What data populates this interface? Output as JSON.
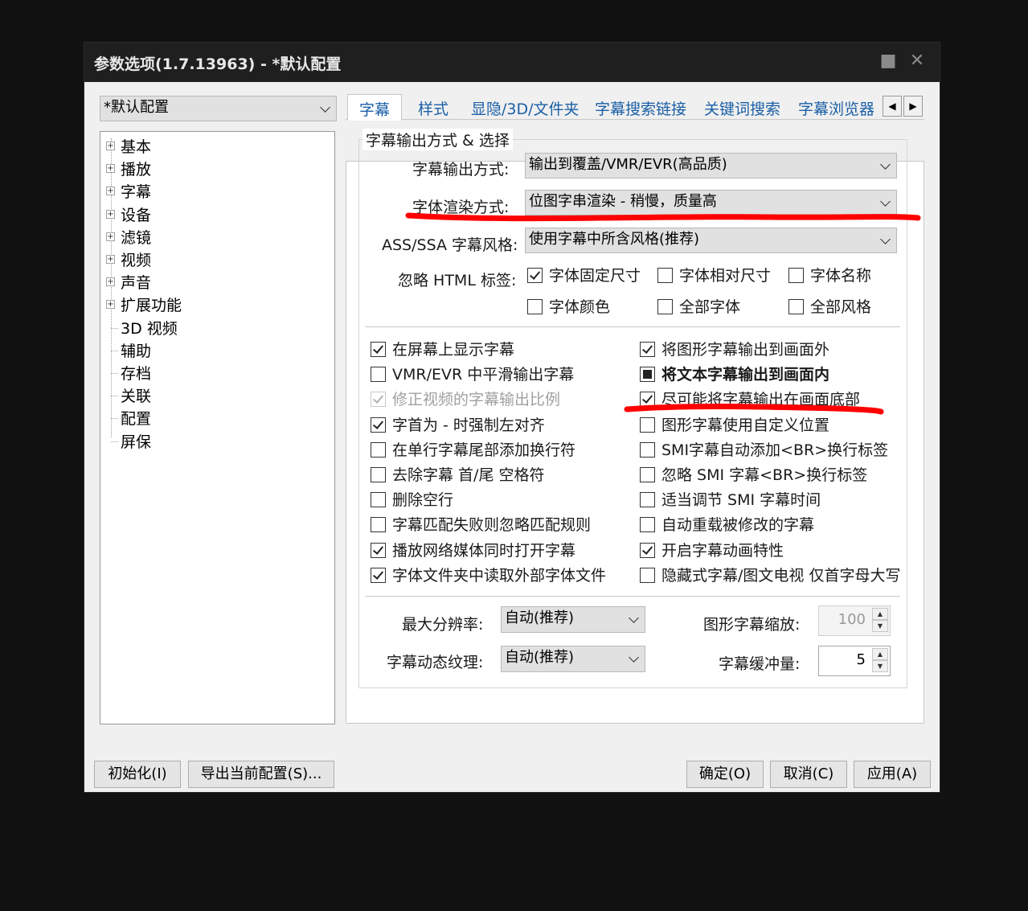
{
  "window": {
    "title": "参数选项(1.7.13963) - *默认配置",
    "pin_icon": "pin-icon",
    "close_icon": "close-icon"
  },
  "profile": {
    "value": "*默认配置"
  },
  "tree": {
    "items": [
      {
        "label": "基本",
        "expandable": true
      },
      {
        "label": "播放",
        "expandable": true
      },
      {
        "label": "字幕",
        "expandable": true
      },
      {
        "label": "设备",
        "expandable": true
      },
      {
        "label": "滤镜",
        "expandable": true
      },
      {
        "label": "视频",
        "expandable": true
      },
      {
        "label": "声音",
        "expandable": true
      },
      {
        "label": "扩展功能",
        "expandable": true
      },
      {
        "label": "3D 视频",
        "expandable": false
      },
      {
        "label": "辅助",
        "expandable": false
      },
      {
        "label": "存档",
        "expandable": false
      },
      {
        "label": "关联",
        "expandable": false
      },
      {
        "label": "配置",
        "expandable": false
      },
      {
        "label": "屏保",
        "expandable": false
      }
    ]
  },
  "tabs": [
    {
      "label": "字幕",
      "active": true
    },
    {
      "label": "样式"
    },
    {
      "label": "显隐/3D/文件夹"
    },
    {
      "label": "字幕搜索链接"
    },
    {
      "label": "关键词搜索"
    },
    {
      "label": "字幕浏览器"
    }
  ],
  "tab_scroll": {
    "left_icon": "arrow-left-icon",
    "right_icon": "arrow-right-icon",
    "left": "◀",
    "right": "▶"
  },
  "group": {
    "title": "字幕输出方式 & 选择",
    "output_mode_label": "字幕输出方式:",
    "output_mode_value": "输出到覆盖/VMR/EVR(高品质)",
    "font_render_label": "字体渲染方式:",
    "font_render_value": "位图字串渲染 - 稍慢，质量高",
    "ass_label": "ASS/SSA 字幕风格:",
    "ass_value": "使用字幕中所含风格(推荐)",
    "ignore_html_label": "忽略 HTML 标签:",
    "ignore_html": [
      {
        "label": "字体固定尺寸",
        "checked": true
      },
      {
        "label": "字体相对尺寸",
        "checked": false
      },
      {
        "label": "字体名称",
        "checked": false
      },
      {
        "label": "字体颜色",
        "checked": false
      },
      {
        "label": "全部字体",
        "checked": false
      },
      {
        "label": "全部风格",
        "checked": false
      }
    ],
    "options_left": [
      {
        "label": "在屏幕上显示字幕",
        "state": "checked"
      },
      {
        "label": "VMR/EVR 中平滑输出字幕",
        "state": "unchecked"
      },
      {
        "label": "修正视频的字幕输出比例",
        "state": "disabled-checked"
      },
      {
        "label": "字首为 - 时强制左对齐",
        "state": "checked"
      },
      {
        "label": "在单行字幕尾部添加换行符",
        "state": "unchecked"
      },
      {
        "label": "去除字幕 首/尾 空格符",
        "state": "unchecked"
      },
      {
        "label": "删除空行",
        "state": "unchecked"
      },
      {
        "label": "字幕匹配失败则忽略匹配规则",
        "state": "unchecked"
      },
      {
        "label": "播放网络媒体同时打开字幕",
        "state": "checked"
      },
      {
        "label": "字体文件夹中读取外部字体文件",
        "state": "checked"
      }
    ],
    "options_right": [
      {
        "label": "将图形字幕输出到画面外",
        "state": "checked"
      },
      {
        "label": "将文本字幕输出到画面内",
        "state": "indeterminate"
      },
      {
        "label": "尽可能将字幕输出在画面底部",
        "state": "checked"
      },
      {
        "label": "图形字幕使用自定义位置",
        "state": "unchecked"
      },
      {
        "label": "SMI字幕自动添加<BR>换行标签",
        "state": "unchecked"
      },
      {
        "label": "忽略 SMI 字幕<BR>换行标签",
        "state": "unchecked"
      },
      {
        "label": "适当调节 SMI 字幕时间",
        "state": "unchecked"
      },
      {
        "label": "自动重载被修改的字幕",
        "state": "unchecked"
      },
      {
        "label": "开启字幕动画特性",
        "state": "checked"
      },
      {
        "label": "隐藏式字幕/图文电视 仅首字母大写",
        "state": "unchecked"
      }
    ],
    "max_res_label": "最大分辨率:",
    "max_res_value": "自动(推荐)",
    "texture_label": "字幕动态纹理:",
    "texture_value": "自动(推荐)",
    "scale_label": "图形字幕缩放:",
    "scale_value": "100",
    "buffer_label": "字幕缓冲量:",
    "buffer_value": "5"
  },
  "buttons": {
    "init": "初始化(I)",
    "export": "导出当前配置(S)...",
    "ok": "确定(O)",
    "cancel": "取消(C)",
    "apply": "应用(A)"
  },
  "annotation_color": "#ff0000"
}
